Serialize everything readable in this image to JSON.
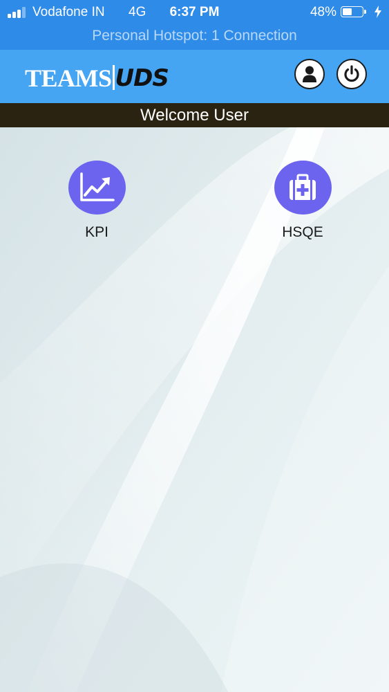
{
  "status_bar": {
    "carrier": "Vodafone IN",
    "network": "4G",
    "time": "6:37 PM",
    "battery_percent": "48%",
    "battery_level": 0.48,
    "hotspot_text": "Personal Hotspot: 1 Connection"
  },
  "header": {
    "logo_part1": "TEAMS",
    "logo_part2": "UDS",
    "icons": {
      "profile": "user-icon",
      "logout": "power-icon"
    }
  },
  "welcome_text": "Welcome User",
  "tiles": [
    {
      "label": "KPI",
      "icon": "chart-trend-icon"
    },
    {
      "label": "HSQE",
      "icon": "medical-kit-icon"
    }
  ],
  "colors": {
    "status_bar_bg": "#2f8be8",
    "header_bg": "#45a5f3",
    "welcome_bg": "#2a2312",
    "tile_accent": "#6c63ee"
  }
}
